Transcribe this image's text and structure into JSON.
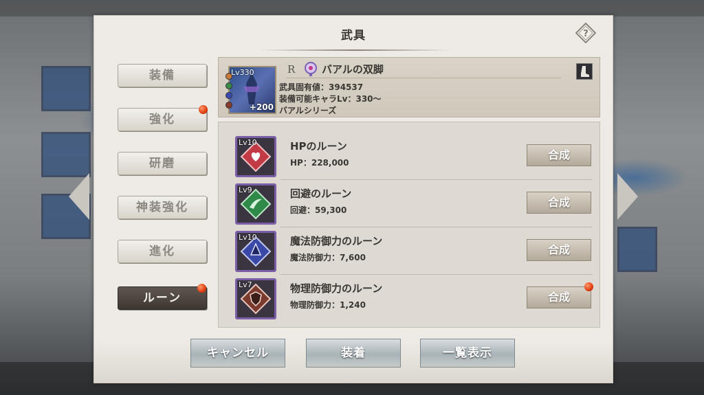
{
  "dialog": {
    "title": "武具",
    "help_icon": "question-diamond-icon"
  },
  "sidebar": {
    "items": [
      {
        "label": "装備",
        "active": false,
        "badge": false
      },
      {
        "label": "強化",
        "active": false,
        "badge": true
      },
      {
        "label": "研磨",
        "active": false,
        "badge": false
      },
      {
        "label": "神装強化",
        "active": false,
        "badge": false
      },
      {
        "label": "進化",
        "active": false,
        "badge": false
      },
      {
        "label": "ルーン",
        "active": true,
        "badge": true
      }
    ]
  },
  "weapon": {
    "level": "Lv330",
    "plus": "+200",
    "rarity": "R",
    "name": "バアルの双脚",
    "value_line": "武具固有値：394537",
    "equip_line": "装備可能キャラLv：330～",
    "series_line": "バアルシリーズ",
    "type_icon": "boots-icon"
  },
  "runes": [
    {
      "level": "Lv10",
      "name": "HPのルーン",
      "stat": "HP：228,000",
      "button": "合成",
      "badge": false,
      "color": "#c23a45"
    },
    {
      "level": "Lv9",
      "name": "回避のルーン",
      "stat": "回避：59,300",
      "button": "合成",
      "badge": false,
      "color": "#2f8a4a"
    },
    {
      "level": "Lv10",
      "name": "魔法防御力のルーン",
      "stat": "魔法防御力：7,600",
      "button": "合成",
      "badge": false,
      "color": "#3a48a8"
    },
    {
      "level": "Lv7",
      "name": "物理防御力のルーン",
      "stat": "物理防御力：1,240",
      "button": "合成",
      "badge": true,
      "color": "#8a3a2a"
    }
  ],
  "footer": {
    "cancel": "キャンセル",
    "equip": "装着",
    "list": "一覧表示"
  }
}
